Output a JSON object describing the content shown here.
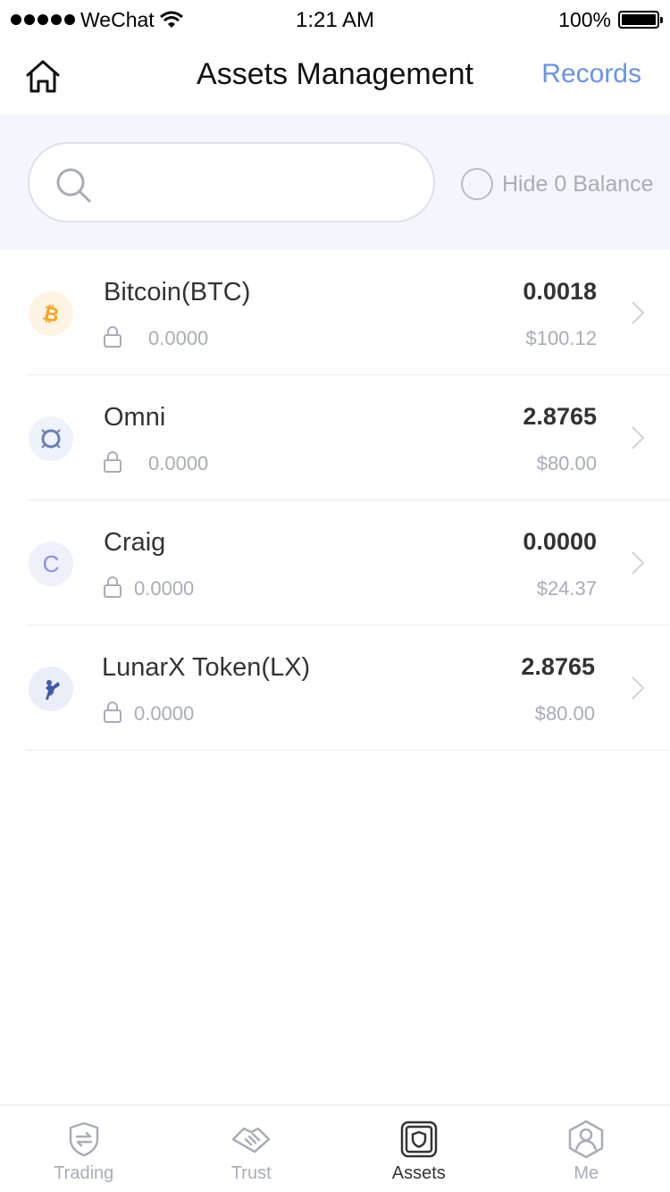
{
  "status_bar": {
    "carrier": "WeChat",
    "time": "1:21 AM",
    "battery": "100%"
  },
  "header": {
    "title": "Assets Management",
    "records_label": "Records"
  },
  "search": {
    "placeholder": "",
    "hide_zero_label": "Hide 0 Balance"
  },
  "assets": [
    {
      "name": "Bitcoin(BTC)",
      "locked": "0.0000",
      "balance": "0.0018",
      "usd": "$100.12",
      "icon": "bitcoin-icon"
    },
    {
      "name": "Omni",
      "locked": "0.0000",
      "balance": "2.8765",
      "usd": "$80.00",
      "icon": "omni-icon"
    },
    {
      "name": "Craig",
      "locked": "0.0000",
      "balance": "0.0000",
      "usd": "$24.37",
      "icon": "craig-letter-icon",
      "icon_letter": "C"
    },
    {
      "name": "LunarX Token(LX)",
      "locked": "0.0000",
      "balance": "2.8765",
      "usd": "$80.00",
      "icon": "lunarx-icon"
    }
  ],
  "tabs": [
    {
      "label": "Trading",
      "icon": "trading-shield-icon",
      "active": false
    },
    {
      "label": "Trust",
      "icon": "handshake-icon",
      "active": false
    },
    {
      "label": "Assets",
      "icon": "assets-safe-icon",
      "active": true
    },
    {
      "label": "Me",
      "icon": "person-icon",
      "active": false
    }
  ],
  "colors": {
    "accent": "#6b93e6",
    "muted_text": "#a9adb8",
    "search_bg": "#f4f6fb",
    "bitcoin": "#f7a524",
    "craig": "#8d8fe0"
  }
}
